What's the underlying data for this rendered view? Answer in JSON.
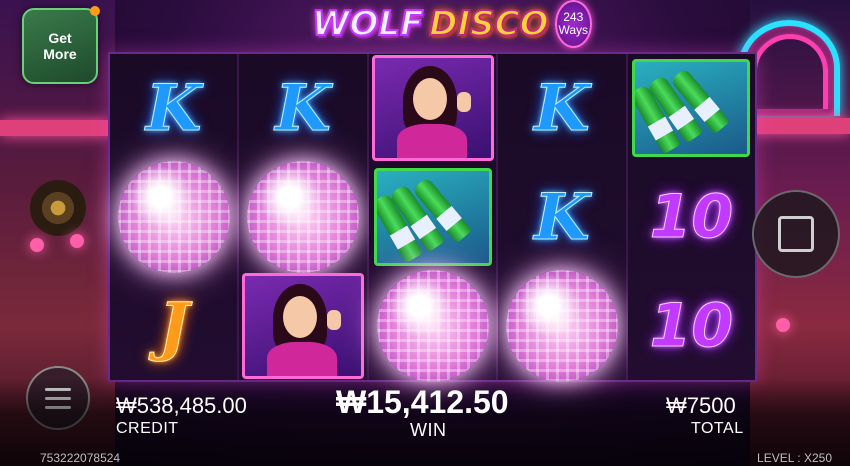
{
  "promo": {
    "label_line1": "Get",
    "label_line2": "More"
  },
  "title": {
    "word1": "WOLF",
    "word2": "DISCO",
    "ways_number": "243",
    "ways_label": "Ways"
  },
  "reels": [
    [
      "K",
      "disco-ball",
      "J"
    ],
    [
      "K",
      "disco-ball",
      "lady"
    ],
    [
      "lady",
      "bottles",
      "disco-ball"
    ],
    [
      "K",
      "K",
      "disco-ball"
    ],
    [
      "bottles",
      "10",
      "10"
    ]
  ],
  "credit": {
    "value": "₩538,485.00",
    "label": "CREDIT"
  },
  "win": {
    "value": "₩15,412.50",
    "label": "WIN"
  },
  "total": {
    "value": "₩7500",
    "label": "TOTAL"
  },
  "footer": {
    "session_id": "753222078524",
    "level_label": "LEVEL : X250"
  },
  "colors": {
    "k_blue": "#1e9aff",
    "j_orange": "#ff9a1a",
    "ten_purple": "#c23aff",
    "frame_pink": "#ff6ad8",
    "bottle_green": "#42d84a"
  },
  "icons": {
    "menu": "hamburger-menu-icon",
    "spin": "stop-square-icon"
  }
}
